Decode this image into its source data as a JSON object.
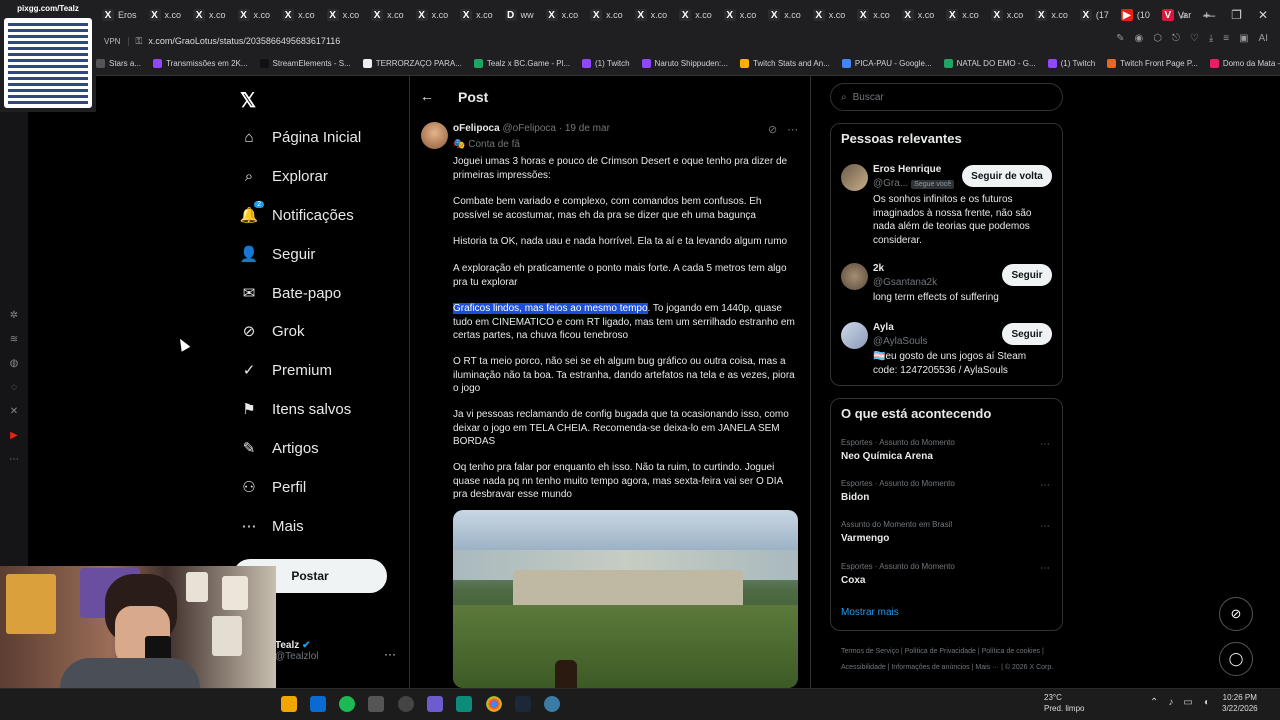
{
  "browser": {
    "tabs": [
      {
        "label": "Eros",
        "icon": "X",
        "kind": "x"
      },
      {
        "label": "x.co",
        "icon": "X",
        "kind": "x"
      },
      {
        "label": "x.co",
        "icon": "X",
        "kind": "x"
      },
      {
        "label": "x.co",
        "icon": "X",
        "kind": "x"
      },
      {
        "label": "x.co",
        "icon": "X",
        "kind": "x"
      },
      {
        "label": "x.co",
        "icon": "X",
        "kind": "x"
      },
      {
        "label": "x.co",
        "icon": "X",
        "kind": "x"
      },
      {
        "label": "x.co",
        "icon": "X",
        "kind": "x"
      },
      {
        "label": "x.co",
        "icon": "X",
        "kind": "x"
      },
      {
        "label": "ww",
        "icon": "D",
        "kind": "x"
      },
      {
        "label": "x.co",
        "icon": "X",
        "kind": "x"
      },
      {
        "label": "x.co",
        "icon": "X",
        "kind": "x"
      },
      {
        "label": "x.co",
        "icon": "X",
        "kind": "x"
      },
      {
        "label": "x.co",
        "icon": "X",
        "kind": "x"
      },
      {
        "label": "x.co",
        "icon": "X",
        "kind": "x"
      },
      {
        "label": "x.co",
        "icon": "X",
        "kind": "x"
      },
      {
        "label": "x.co",
        "icon": "X",
        "kind": "x"
      },
      {
        "label": "x.co",
        "icon": "X",
        "kind": "x"
      },
      {
        "label": "x.co",
        "icon": "X",
        "kind": "x"
      },
      {
        "label": "x.co",
        "icon": "X",
        "kind": "x"
      },
      {
        "label": "x.co",
        "icon": "X",
        "kind": "x"
      },
      {
        "label": "x.co",
        "icon": "X",
        "kind": "x"
      },
      {
        "label": "(17",
        "icon": "X",
        "kind": "x"
      },
      {
        "label": "(10",
        "icon": "▶",
        "kind": "yt"
      },
      {
        "label": "Var",
        "icon": "V",
        "kind": "vr"
      }
    ],
    "new_tab": "+",
    "vpn_label": "VPN",
    "url": "x.com/GraoLotus/status/2035866495683617116",
    "bookmarks": [
      {
        "label": "Stars a...",
        "color": "#555"
      },
      {
        "label": "Transmissões em 2K...",
        "color": "#9146ff"
      },
      {
        "label": "StreamElements - S...",
        "color": "#111"
      },
      {
        "label": "TERRORZAÇO PARA...",
        "color": "#eee"
      },
      {
        "label": "Tealz x BC.Game - Pl...",
        "color": "#1fa463"
      },
      {
        "label": "(1) Twitch",
        "color": "#9146ff"
      },
      {
        "label": "Naruto Shippuden:...",
        "color": "#9146ff"
      },
      {
        "label": "Twitch Stats and An...",
        "color": "#ffb000"
      },
      {
        "label": "PICA-PAU - Google...",
        "color": "#4285f4"
      },
      {
        "label": "NATAL DO EMO - G...",
        "color": "#1fa463"
      },
      {
        "label": "(1) Twitch",
        "color": "#9146ff"
      },
      {
        "label": "Twitch Front Page P...",
        "color": "#e8681f"
      },
      {
        "label": "Domo da Mata - Ho...",
        "color": "#e91e63"
      }
    ],
    "ai_label": "AI"
  },
  "overlay": {
    "qr_label": "pixgg.com/Tealz"
  },
  "nav": {
    "items": [
      {
        "label": "Página Inicial",
        "icon": "home-icon",
        "glyph": "⌂"
      },
      {
        "label": "Explorar",
        "icon": "search-icon",
        "glyph": "⌕"
      },
      {
        "label": "Notificações",
        "icon": "bell-icon",
        "glyph": "🔔",
        "badge": "2"
      },
      {
        "label": "Seguir",
        "icon": "follow-icon",
        "glyph": "👤"
      },
      {
        "label": "Bate-papo",
        "icon": "mail-icon",
        "glyph": "✉"
      },
      {
        "label": "Grok",
        "icon": "grok-icon",
        "glyph": "⊘"
      },
      {
        "label": "Premium",
        "icon": "premium-icon",
        "glyph": "✓"
      },
      {
        "label": "Itens salvos",
        "icon": "bookmark-icon",
        "glyph": "⚑"
      },
      {
        "label": "Artigos",
        "icon": "articles-icon",
        "glyph": "✎"
      },
      {
        "label": "Perfil",
        "icon": "profile-icon",
        "glyph": "⚇"
      },
      {
        "label": "Mais",
        "icon": "more-icon",
        "glyph": "⋯"
      }
    ],
    "post_button": "Postar",
    "account_name": "Tealz",
    "account_handle": "@Tealzlol",
    "account_more": "···"
  },
  "post": {
    "page_title": "Post",
    "author": "oFelipoca",
    "handle": "@oFelipoca",
    "date": "· 19 de mar",
    "fan_label": "Conta de fã",
    "paragraphs": [
      "Joguei umas 3 horas e pouco de Crimson Desert e oque tenho pra dizer de primeiras impressões:",
      "Combate bem variado e complexo, com comandos bem confusos. Eh possível se acostumar, mas eh da pra se dizer que eh uma bagunça",
      "Historia ta OK, nada uau e nada horrível. Ela ta aí e ta levando algum rumo",
      "A exploração eh praticamente o ponto mais forte. A cada 5 metros tem algo pra tu explorar",
      "RT_PLACEHOLDER",
      "O RT ta meio porco, não sei se eh algum bug gráfico ou outra coisa, mas a iluminação não ta boa. Ta estranha, dando artefatos na tela e as vezes, piora o jogo",
      "Ja vi pessoas reclamando de config bugada que ta ocasionando isso, como deixar o jogo em TELA CHEIA. Recomenda-se deixa-lo em JANELA SEM BORDAS",
      "Oq tenho pra falar por enquanto eh isso. Não ta ruim, to curtindo. Joguei quase nada pq nn tenho muito tempo agora, mas sexta-feira vai ser O DIA pra desbravar esse mundo"
    ],
    "highlighted": "Graficos lindos, mas feios ao mesmo tempo",
    "highlight_rest": ". To jogando em 1440p, quase tudo em CINEMATICO e com RT ligado, mas tem um serrilhado estranho em certas partes, na chuva ficou tenebroso"
  },
  "sidebar": {
    "search_placeholder": "Buscar",
    "relevant_title": "Pessoas relevantes",
    "people": [
      {
        "name": "Eros Henrique",
        "handle": "@Gra...",
        "badge": "Segue você",
        "button": "Seguir de volta",
        "bio": "Os sonhos infinitos e os futuros imaginados à nossa frente, não são nada além de teorias que podemos considerar."
      },
      {
        "name": "2k",
        "handle": "@Gsantana2k",
        "badge": "",
        "button": "Seguir",
        "bio": "long term effects of suffering"
      },
      {
        "name": "Ayla",
        "handle": "@AylaSouls",
        "badge": "",
        "button": "Seguir",
        "bio": "🏳️‍⚧️eu gosto de uns jogos aí Steam code: 1247205536 / AylaSouls"
      }
    ],
    "trending_title": "O que está acontecendo",
    "trends": [
      {
        "category": "Esportes · Assunto do Momento",
        "name": "Neo Química Arena"
      },
      {
        "category": "Esportes · Assunto do Momento",
        "name": "Bidon"
      },
      {
        "category": "Assunto do Momento em Brasil",
        "name": "Varmengo"
      },
      {
        "category": "Esportes · Assunto do Momento",
        "name": "Coxa"
      }
    ],
    "show_more": "Mostrar mais",
    "footer": [
      "Termos de Serviço",
      "Política de Privacidade",
      "Política de cookies",
      "Acessibilidade",
      "Informações de anúncios",
      "Mais ···",
      "© 2026 X Corp."
    ]
  },
  "taskbar": {
    "weather_temp": "23°C",
    "weather_desc": "Pred. limpo",
    "time": "10:26 PM",
    "date": "3/22/2026"
  }
}
